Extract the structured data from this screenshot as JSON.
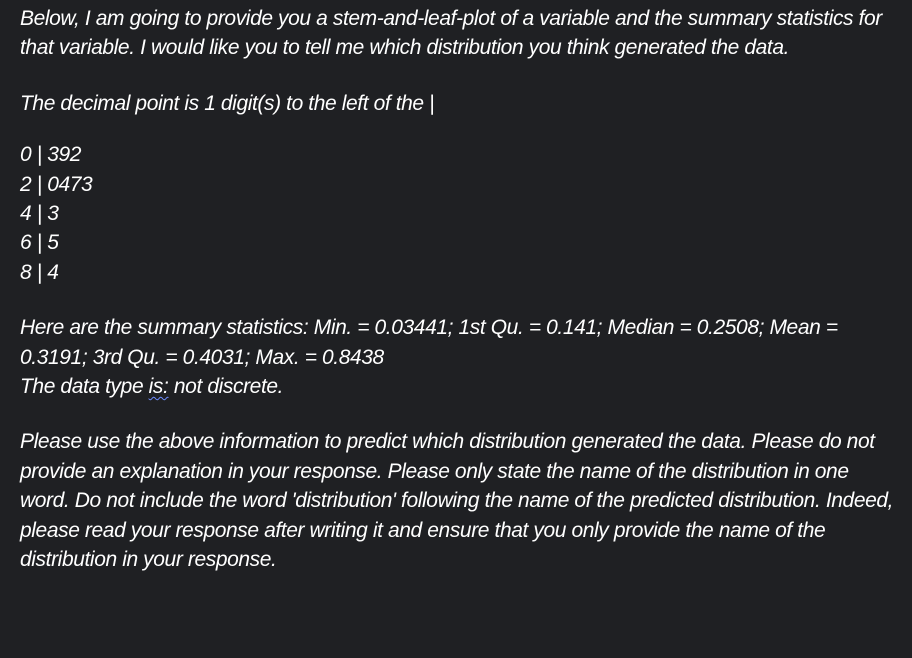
{
  "intro": "Below, I am going to provide you a stem-and-leaf-plot of a variable and the summary statistics for that variable. I would like you to tell me which distribution you think generated the data.",
  "decimal_note": "The decimal point is 1 digit(s) to the left of the |",
  "stem_leaf": [
    "0 | 392",
    "2 | 0473",
    "4 | 3",
    "6 | 5",
    "8 | 4"
  ],
  "summary": "Here are the summary statistics: Min. = 0.03441; 1st Qu. = 0.141; Median = 0.2508; Mean = 0.3191; 3rd Qu. = 0.4031; Max. = 0.8438",
  "data_type": {
    "prefix": "The data type ",
    "flagged_word": "is:",
    "suffix": " not discrete."
  },
  "instructions": "Please use the above information to predict which distribution generated the data. Please do not provide an explanation in your response. Please only state the name of the distribution in one word. Do not include the word 'distribution' following the name of the predicted distribution. Indeed, please read your response after writing it and ensure that you only provide the name of the distribution in your response.",
  "colors": {
    "background": "#1f2023",
    "text": "#ffffff",
    "spellcheck_underline": "#6f8cff"
  }
}
